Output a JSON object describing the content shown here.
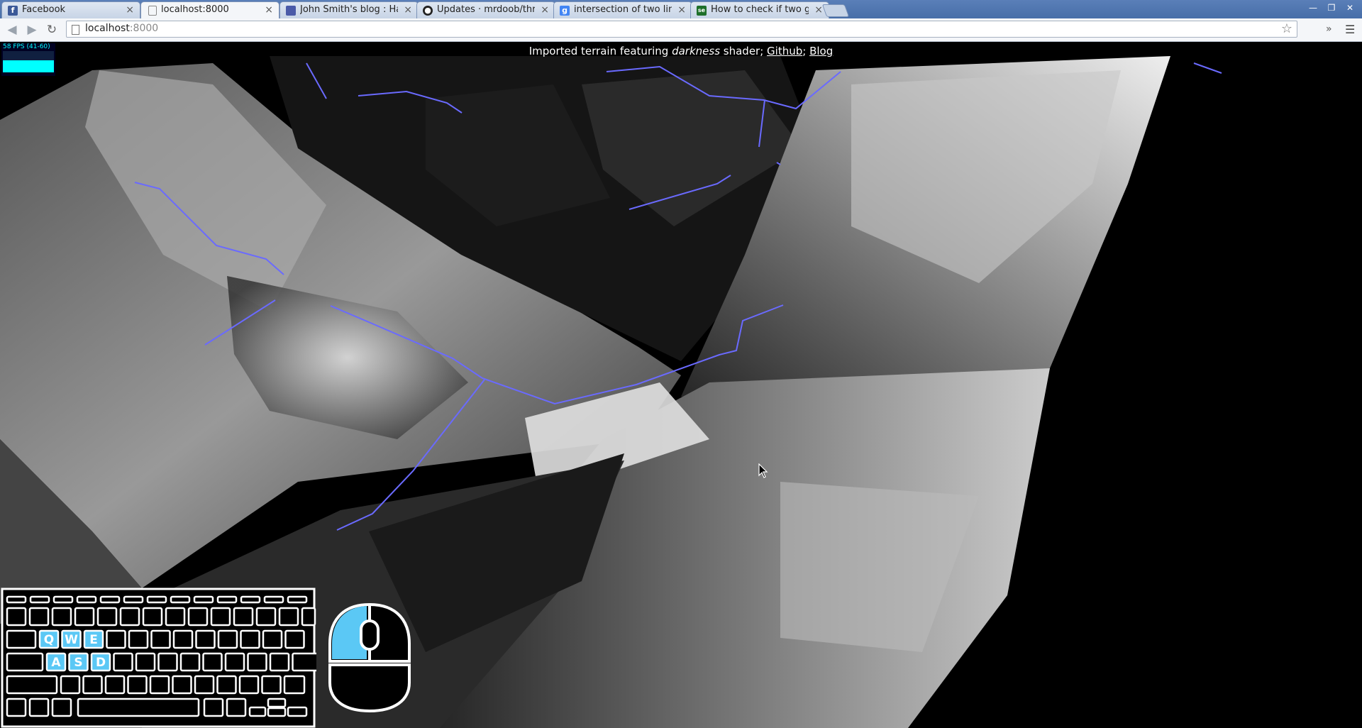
{
  "tabs": [
    {
      "label": "Facebook",
      "icon": "facebook-icon",
      "color": "#3b5998",
      "glyph": "f",
      "active": false
    },
    {
      "label": "localhost:8000",
      "icon": "page-icon",
      "color": "#ffffff",
      "glyph": "",
      "active": true
    },
    {
      "label": "John Smith's blog : Ha",
      "icon": "blog-icon",
      "color": "#4a5aa8",
      "glyph": "",
      "active": false
    },
    {
      "label": "Updates · mrdoob/thr",
      "icon": "github-icon",
      "color": "#222222",
      "glyph": "●",
      "active": false
    },
    {
      "label": "intersection of two line",
      "icon": "google-icon",
      "color": "#4285f4",
      "glyph": "g",
      "active": false
    },
    {
      "label": "How to check if two g",
      "icon": "stackexchange-icon",
      "color": "#1e6f2a",
      "glyph": "se",
      "active": false
    }
  ],
  "window_controls": {
    "minimize": "—",
    "restore": "❐",
    "close": "✕"
  },
  "address": {
    "host": "localhost",
    "port": ":8000"
  },
  "caption": {
    "prefix": "Imported terrain featuring ",
    "emphasis": "darkness",
    "middle": " shader; ",
    "link1": "Github",
    "separator": "; ",
    "link2": "Blog"
  },
  "fps": {
    "text": "58 FPS (41-60)",
    "level": 0.58
  },
  "keyboard": {
    "highlight_color": "#5bc8f5",
    "highlighted_keys": [
      "Q",
      "W",
      "E",
      "A",
      "S",
      "D"
    ]
  },
  "mouse": {
    "left_button_highlighted": true,
    "highlight_color": "#5bc8f5"
  },
  "colors": {
    "path_line": "#6a6aff",
    "background": "#000000"
  }
}
